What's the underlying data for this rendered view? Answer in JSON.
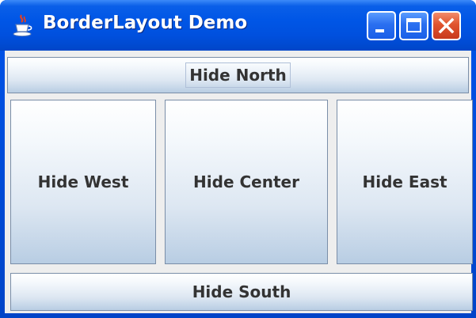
{
  "window": {
    "title": "BorderLayout Demo",
    "icon": "java-cup-icon",
    "controls": [
      "minimize-icon",
      "maximize-icon",
      "close-icon"
    ]
  },
  "buttons": {
    "north": "Hide North",
    "west": "Hide West",
    "center": "Hide Center",
    "east": "Hide East",
    "south": "Hide South"
  },
  "colors": {
    "titlebar": "#0054e3",
    "client_background": "#eeeeee",
    "button_border": "#7a8ea8",
    "close_button": "#e0542e"
  }
}
